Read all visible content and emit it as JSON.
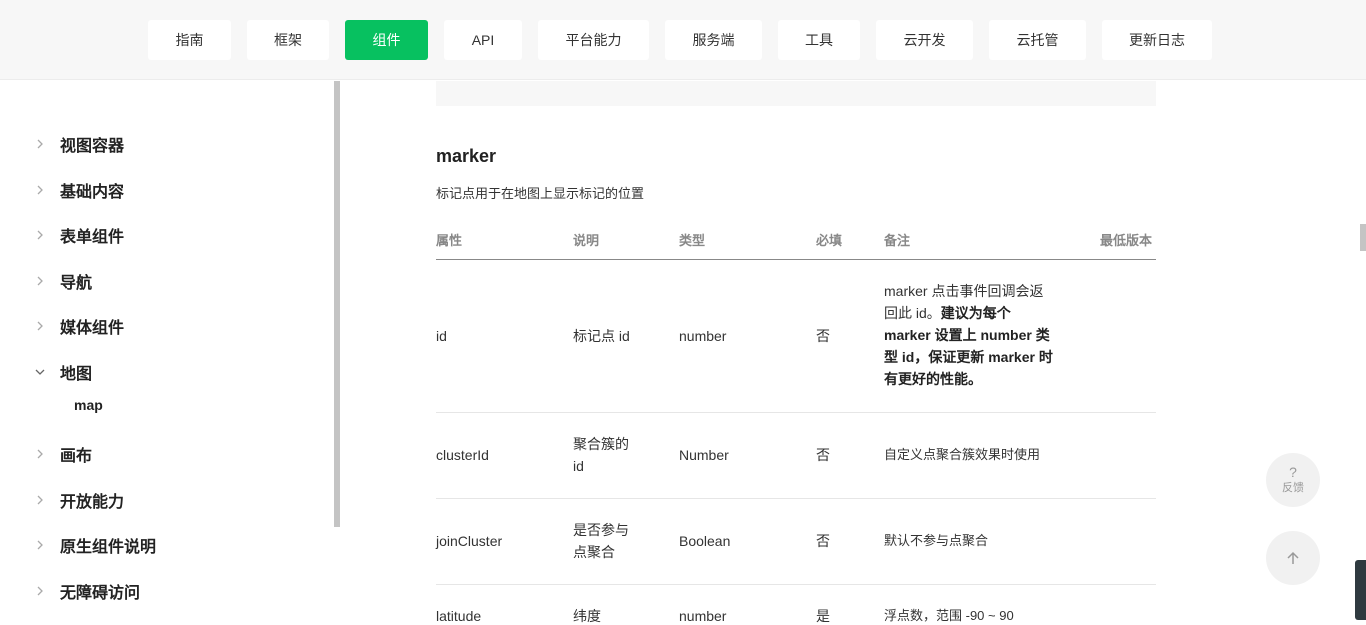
{
  "nav": {
    "items": [
      {
        "label": "指南"
      },
      {
        "label": "框架"
      },
      {
        "label": "组件"
      },
      {
        "label": "API"
      },
      {
        "label": "平台能力"
      },
      {
        "label": "服务端"
      },
      {
        "label": "工具"
      },
      {
        "label": "云开发"
      },
      {
        "label": "云托管"
      },
      {
        "label": "更新日志"
      }
    ],
    "active": "组件"
  },
  "sidebar": {
    "items": [
      {
        "label": "视图容器"
      },
      {
        "label": "基础内容"
      },
      {
        "label": "表单组件"
      },
      {
        "label": "导航"
      },
      {
        "label": "媒体组件"
      },
      {
        "label": "地图",
        "expanded": true
      },
      {
        "label": "画布"
      },
      {
        "label": "开放能力"
      },
      {
        "label": "原生组件说明"
      },
      {
        "label": "无障碍访问"
      }
    ],
    "subitem": "map"
  },
  "section": {
    "title": "marker",
    "description": "标记点用于在地图上显示标记的位置"
  },
  "table": {
    "headers": [
      "属性",
      "说明",
      "类型",
      "必填",
      "备注",
      "最低版本"
    ],
    "rows": [
      {
        "attr": "id",
        "desc": "标记点 id",
        "type": "number",
        "required": "否",
        "note_lines": [
          {
            "text": "marker 点击事件回调会返",
            "bold": false
          },
          {
            "text": "回此 id。",
            "bold": false,
            "bold_suffix": "建议为每个"
          },
          {
            "text": "marker 设置上 number 类",
            "bold": true
          },
          {
            "text": "型 id，保证更新 marker 时",
            "bold": true
          },
          {
            "text": "有更好的性能。",
            "bold": true
          }
        ]
      },
      {
        "attr": "clusterId",
        "desc_lines": [
          "聚合簇的",
          "id"
        ],
        "type": "Number",
        "required": "否",
        "note": "自定义点聚合簇效果时使用"
      },
      {
        "attr": "joinCluster",
        "desc_lines": [
          "是否参与",
          "点聚合"
        ],
        "type": "Boolean",
        "required": "否",
        "note": "默认不参与点聚合"
      },
      {
        "attr": "latitude",
        "desc": "纬度",
        "type": "number",
        "required": "是",
        "note": "浮点数，范围 -90 ~ 90"
      }
    ]
  },
  "widgets": {
    "feedback_icon": "?",
    "feedback_label": "反馈",
    "back_to_top_icon": "arrow-up-icon"
  },
  "colors": {
    "accent": "#07c160",
    "nav_bg": "#f7f7f7",
    "header_text": "#888888"
  }
}
